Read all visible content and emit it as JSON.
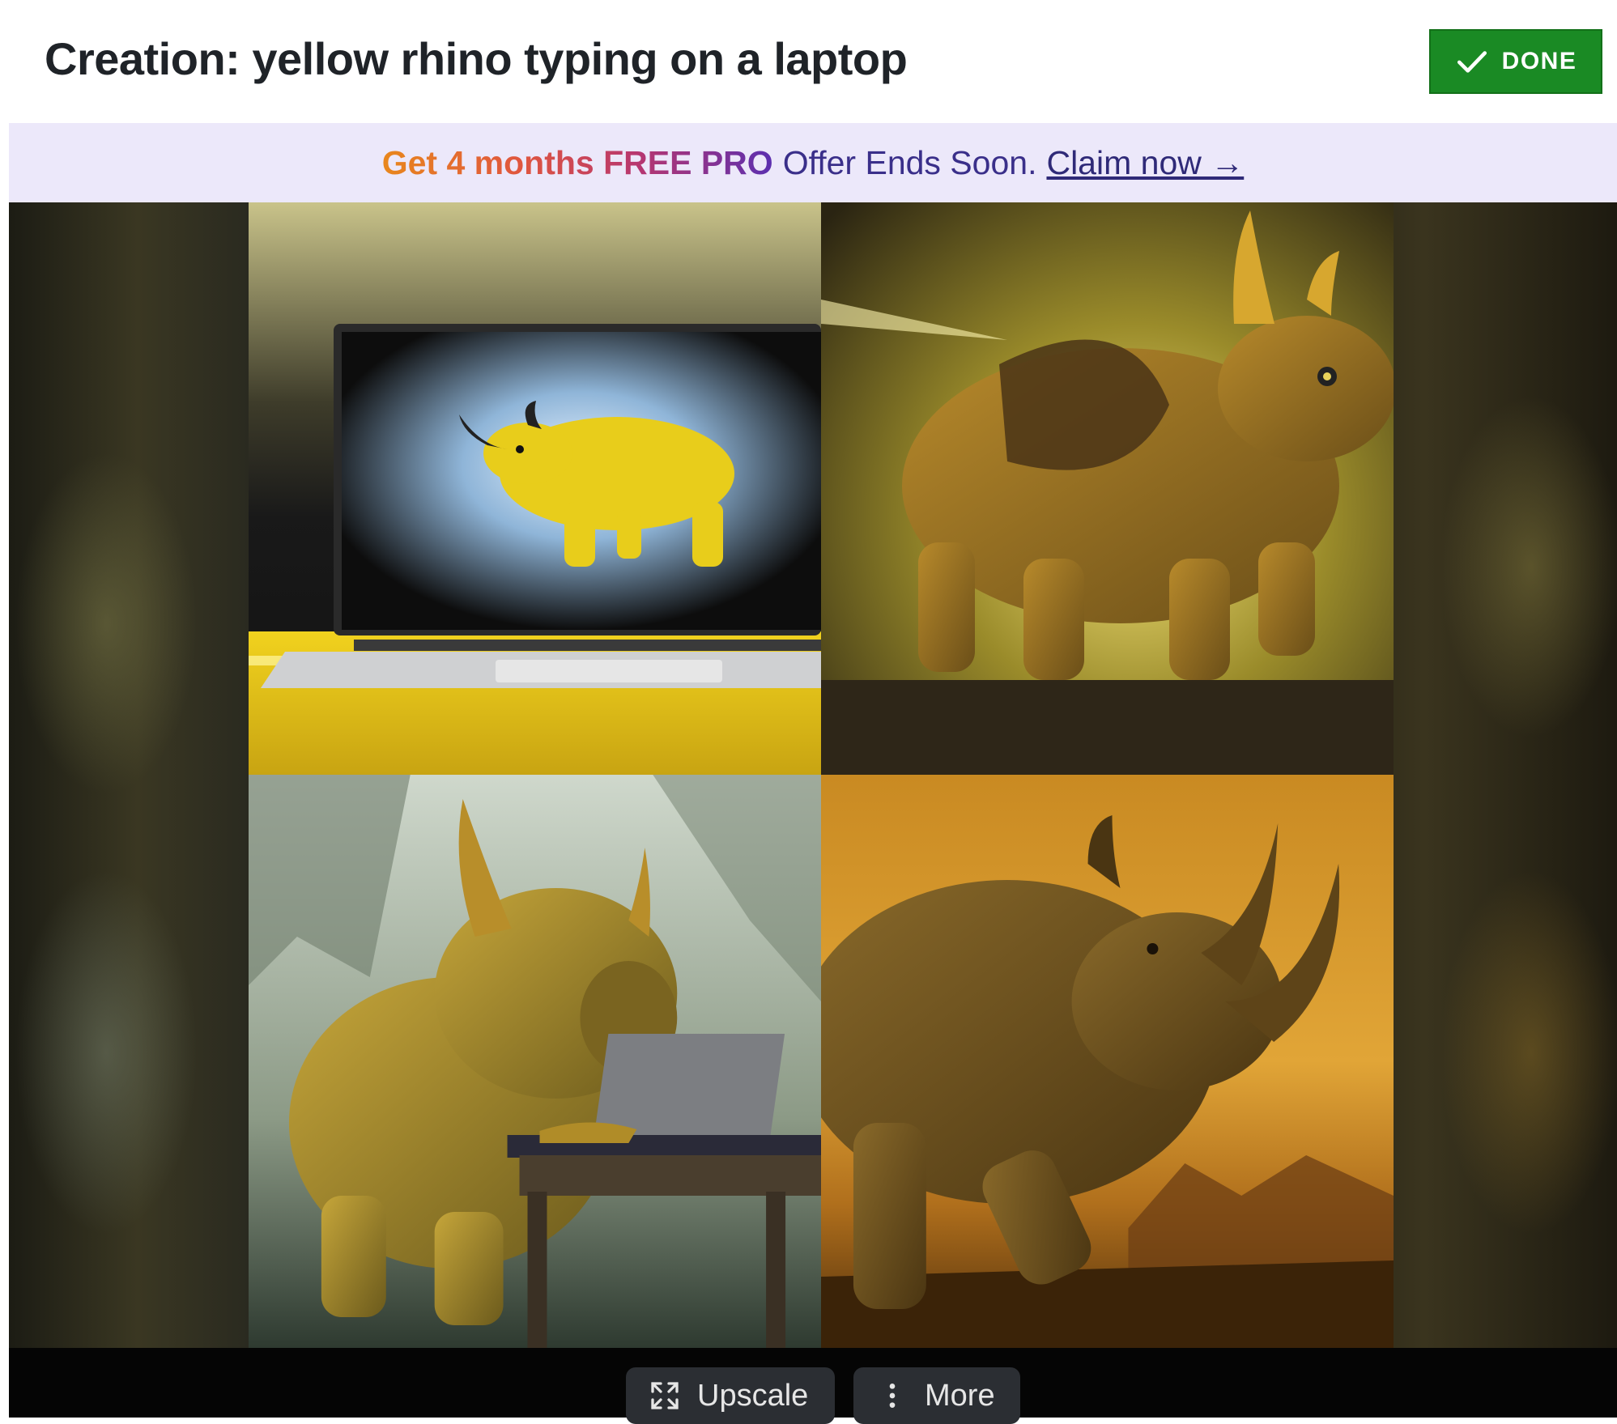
{
  "header": {
    "title": "Creation: yellow rhino typing on a laptop",
    "done_label": "DONE",
    "done_icon": "checkmark-icon",
    "done_color": "#1a8a24"
  },
  "promo": {
    "highlight": "Get 4 months FREE PRO",
    "text": "Offer Ends Soon.",
    "link": "Claim now →"
  },
  "images": [
    {
      "subject": "yellow rhino on a laptop screen"
    },
    {
      "subject": "golden rhino with saddle"
    },
    {
      "subject": "yellow rhino typing at a desk"
    },
    {
      "subject": "brown rhino in desert sunset"
    }
  ],
  "actions": {
    "upscale_label": "Upscale",
    "upscale_icon": "expand-icon",
    "more_label": "More",
    "more_icon": "kebab-menu-icon"
  }
}
